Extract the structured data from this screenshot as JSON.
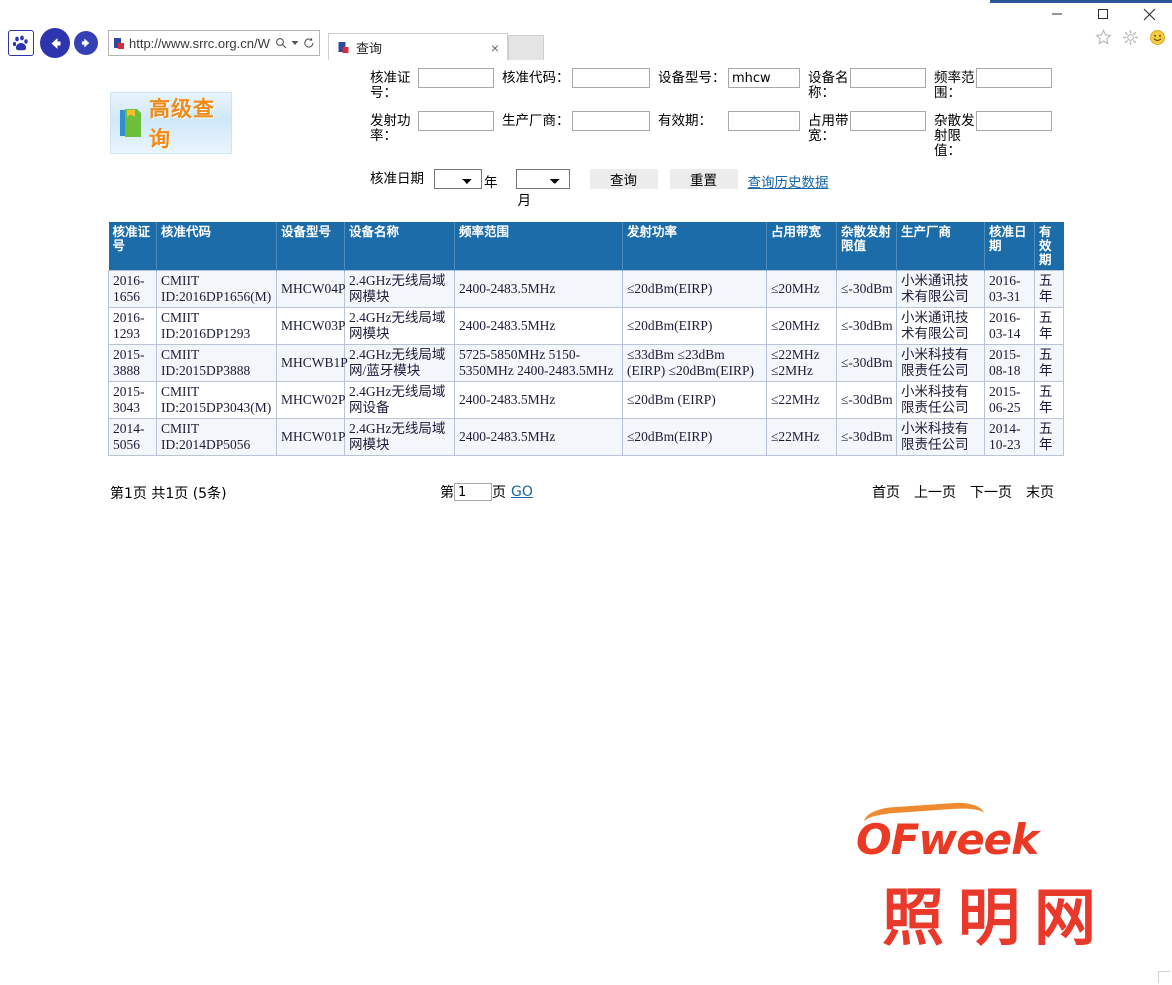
{
  "browser": {
    "address_url": "http://www.srrc.org.cn/WP_",
    "address_placeholder": "",
    "tab_title": "查询",
    "tab_close_label": "×",
    "icons": {
      "baidu_paw": "paw-icon",
      "back": "back-arrow-icon",
      "forward": "forward-arrow-icon",
      "search": "search-icon",
      "dropdown": "chevron-down-icon",
      "refresh": "refresh-icon",
      "favorites": "star-icon",
      "settings": "gear-icon",
      "smiley": "smiley-icon",
      "minimize": "minimize-icon",
      "maximize": "maximize-icon",
      "close": "close-icon"
    }
  },
  "banner": {
    "text": "高级查询",
    "icon": "folder-icon"
  },
  "form": {
    "labels": {
      "cert_no": "核准证号：",
      "cert_code": "核准代码：",
      "device_model": "设备型号：",
      "device_name": "设备名称：",
      "freq_range": "频率范围：",
      "tx_power": "发射功率：",
      "manufacturer": "生产厂商：",
      "valid_period": "有效期：",
      "bandwidth": "占用带宽：",
      "spurious_limit": "杂散发射限值：",
      "approve_date": "核准日期"
    },
    "values": {
      "cert_no": "",
      "cert_code": "",
      "device_model": "mhcw",
      "device_name": "",
      "freq_range": "",
      "tx_power": "",
      "manufacturer": "",
      "valid_period": "",
      "bandwidth": "",
      "spurious_limit": ""
    },
    "date": {
      "year_value": "",
      "year_unit": "年",
      "month_value": "",
      "month_unit": "月"
    },
    "buttons": {
      "query": "查询",
      "reset": "重置",
      "history_link": "查询历史数据"
    }
  },
  "table": {
    "headers": [
      "核准证号",
      "核准代码",
      "设备型号",
      "设备名称",
      "频率范围",
      "发射功率",
      "占用带宽",
      "杂散发射限值",
      "生产厂商",
      "核准日期",
      "有效期"
    ],
    "rows": [
      {
        "cert_no": "2016-1656",
        "cert_code": "CMIIT ID:2016DP1656(M)",
        "model": "MHCW04P",
        "name": "2.4GHz无线局域网模块",
        "freq": "2400-2483.5MHz",
        "power": "≤20dBm(EIRP)",
        "bandwidth": "≤20MHz",
        "spurious": "≤-30dBm",
        "manufacturer": "小米通讯技术有限公司",
        "date": "2016-03-31",
        "valid": "五年"
      },
      {
        "cert_no": "2016-1293",
        "cert_code": "CMIIT ID:2016DP1293",
        "model": "MHCW03P",
        "name": "2.4GHz无线局域网模块",
        "freq": "2400-2483.5MHz",
        "power": "≤20dBm(EIRP)",
        "bandwidth": "≤20MHz",
        "spurious": "≤-30dBm",
        "manufacturer": "小米通讯技术有限公司",
        "date": "2016-03-14",
        "valid": "五年"
      },
      {
        "cert_no": "2015-3888",
        "cert_code": "CMIIT ID:2015DP3888",
        "model": "MHCWB1P",
        "name": "2.4GHz无线局域网/蓝牙模块",
        "freq": "5725-5850MHz 5150-5350MHz 2400-2483.5MHz",
        "power": "≤33dBm ≤23dBm (EIRP) ≤20dBm(EIRP)",
        "bandwidth": "≤22MHz ≤2MHz",
        "spurious": "≤-30dBm",
        "manufacturer": "小米科技有限责任公司",
        "date": "2015-08-18",
        "valid": "五年"
      },
      {
        "cert_no": "2015-3043",
        "cert_code": "CMIIT ID:2015DP3043(M)",
        "model": "MHCW02P",
        "name": "2.4GHz无线局域网设备",
        "freq": "2400-2483.5MHz",
        "power": "≤20dBm (EIRP)",
        "bandwidth": "≤22MHz",
        "spurious": "≤-30dBm",
        "manufacturer": "小米科技有限责任公司",
        "date": "2015-06-25",
        "valid": "五年"
      },
      {
        "cert_no": "2014-5056",
        "cert_code": "CMIIT ID:2014DP5056",
        "model": "MHCW01P",
        "name": "2.4GHz无线局域网模块",
        "freq": "2400-2483.5MHz",
        "power": "≤20dBm(EIRP)",
        "bandwidth": "≤22MHz",
        "spurious": "≤-30dBm",
        "manufacturer": "小米科技有限责任公司",
        "date": "2014-10-23",
        "valid": "五年"
      }
    ]
  },
  "pagination": {
    "summary": "第1页 共1页 (5条)",
    "jump_prefix": "第",
    "jump_value": "1",
    "jump_suffix": "页",
    "go_label": "GO",
    "first": "首页",
    "prev": "上一页",
    "next": "下一页",
    "last": "末页"
  },
  "watermark": {
    "brand": "OFweek",
    "site": "照明网"
  },
  "colors": {
    "table_header_bg": "#1b6ca8",
    "link": "#1764a8",
    "banner_text": "#f08a18",
    "watermark_red": "#e8392a",
    "nav_blue": "#2c35ad"
  }
}
